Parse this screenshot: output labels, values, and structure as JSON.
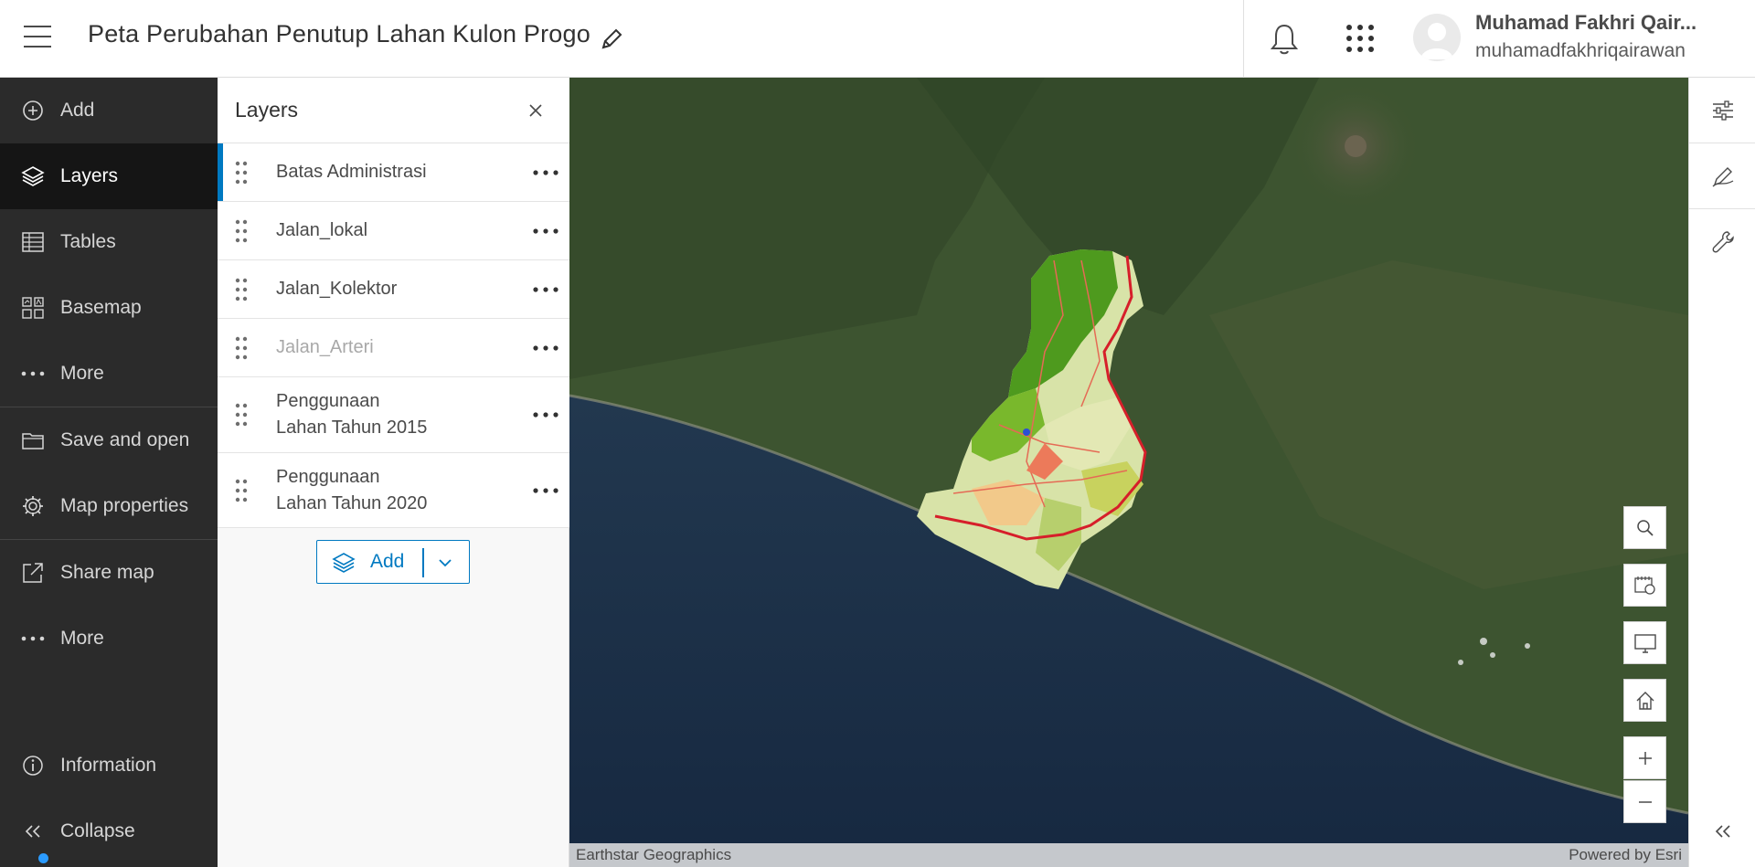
{
  "header": {
    "map_title": "Peta Perubahan Penutup Lahan Kulon Progo",
    "user_name": "Muhamad Fakhri Qair...",
    "username": "muhamadfakhriqairawan"
  },
  "leftnav": {
    "items": [
      {
        "label": "Add",
        "icon": "plus-circle-icon"
      },
      {
        "label": "Layers",
        "icon": "layers-icon",
        "active": true
      },
      {
        "label": "Tables",
        "icon": "table-icon"
      },
      {
        "label": "Basemap",
        "icon": "basemap-icon"
      },
      {
        "label": "More",
        "icon": "ellipsis-icon"
      },
      {
        "label": "Save and open",
        "icon": "folder-icon"
      },
      {
        "label": "Map properties",
        "icon": "gear-icon"
      },
      {
        "label": "Share map",
        "icon": "share-icon"
      },
      {
        "label": "More",
        "icon": "ellipsis-icon"
      },
      {
        "label": "Information",
        "icon": "info-icon"
      },
      {
        "label": "Collapse",
        "icon": "chevrons-left-icon"
      }
    ]
  },
  "layers_panel": {
    "title": "Layers",
    "layers": [
      {
        "name": "Batas Administrasi",
        "selected": true,
        "visible": true
      },
      {
        "name": "Jalan_lokal",
        "visible": true
      },
      {
        "name": "Jalan_Kolektor",
        "visible": true
      },
      {
        "name": "Jalan_Arteri",
        "visible": false
      },
      {
        "name_line1": "Penggunaan",
        "name_line2": "Lahan Tahun 2015",
        "visible": true
      },
      {
        "name_line1": "Penggunaan",
        "name_line2": "Lahan Tahun 2020",
        "visible": true
      }
    ],
    "add_button": "Add"
  },
  "map": {
    "attribution_left": "Earthstar Geographics",
    "attribution_right": "Powered by Esri",
    "controls": [
      "search-icon",
      "basemap-gallery-icon",
      "fullscreen-icon",
      "home-icon",
      "zoom-in-icon",
      "zoom-out-icon"
    ]
  },
  "rightbar": {
    "tools": [
      "properties-icon",
      "sketch-icon",
      "analysis-icon"
    ],
    "collapse": "chevrons-left-icon"
  },
  "colors": {
    "accent": "#0079c1",
    "nav_bg": "#2b2b2b",
    "nav_active": "#151515",
    "sea": "#1b2f47",
    "land": "#3f5630"
  }
}
